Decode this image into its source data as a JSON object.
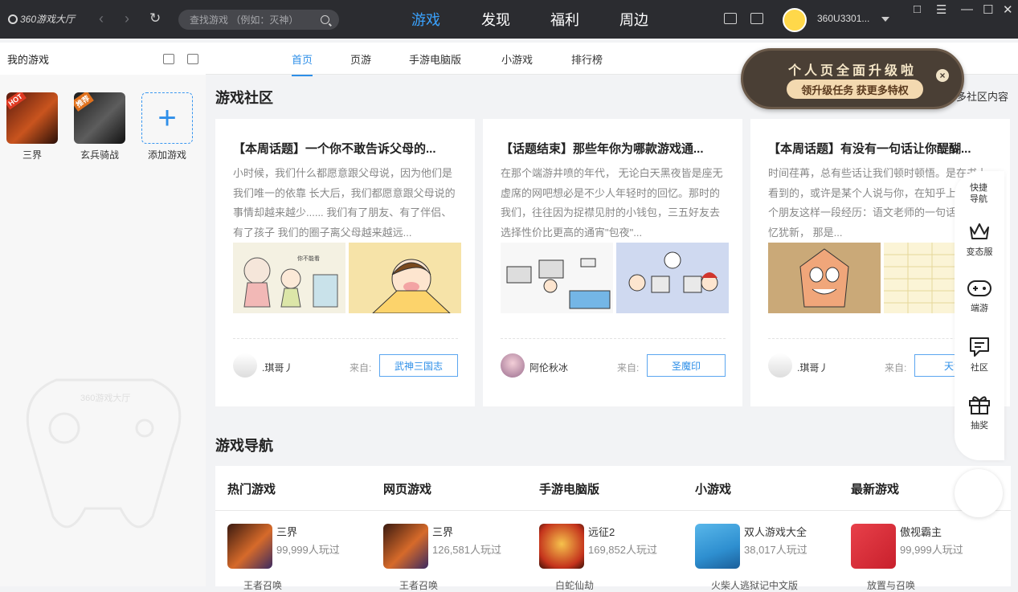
{
  "topbar": {
    "logo_text": "360游戏大厅",
    "search_placeholder": "查找游戏 （例如：灭神）",
    "tabs": [
      "游戏",
      "发现",
      "福利",
      "周边"
    ],
    "username": "360U3301..."
  },
  "sidebar": {
    "title": "我的游戏",
    "games": [
      {
        "name": "三界",
        "badge": "HOT"
      },
      {
        "name": "玄兵骑战",
        "badge": "推荐"
      }
    ],
    "add_label": "添加游戏",
    "watermark": "360游戏大厅"
  },
  "subnav": {
    "tabs": [
      "首页",
      "页游",
      "手游电脑版",
      "小游戏",
      "排行榜"
    ]
  },
  "community": {
    "title": "游戏社区",
    "more": "多社区内容",
    "from_label": "来自:",
    "cards": [
      {
        "title": "【本周话题】一个你不敢告诉父母的...",
        "desc": "小时候，我们什么都愿意跟父母说，因为他们是我们唯一的依靠 长大后，我们都愿意跟父母说的事情却越来越少...... 我们有了朋友、有了伴侣、有了孩子 我们的圈子离父母越来越远...",
        "user": ".琪哥丿",
        "tag": "武神三国志",
        "img_text": "你不能看"
      },
      {
        "title": "【话题结束】那些年你为哪款游戏通...",
        "desc": "在那个端游井喷的年代， 无论白天黑夜皆是座无虚席的网吧想必是不少人年轻时的回忆。那时的我们，往往因为捉襟见肘的小钱包，三五好友去选择性价比更高的通宵\"包夜\"...",
        "user": "阿伦秋冰",
        "tag": "圣魔印",
        "img_text": ""
      },
      {
        "title": "【本周话题】有没有一句话让你醍醐...",
        "desc": "时间荏苒，总有些话让我们顿时顿悟。是在书上看到的，或许是某个人说与你，在知乎上看到一个朋友这样一段经历：语文老师的一句话让我记忆犹新， 那是...",
        "user": ".琪哥丿",
        "tag": "天命",
        "img_text": ""
      }
    ]
  },
  "game_nav": {
    "title": "游戏导航",
    "columns": [
      {
        "header": "热门游戏",
        "name": "三界",
        "players": "99,999人玩过",
        "next": "王者召唤"
      },
      {
        "header": "网页游戏",
        "name": "三界",
        "players": "126,581人玩过",
        "next": "王者召唤"
      },
      {
        "header": "手游电脑版",
        "name": "远征2",
        "players": "169,852人玩过",
        "next": "白蛇仙劫"
      },
      {
        "header": "小游戏",
        "name": "双人游戏大全",
        "players": "38,017人玩过",
        "next": "火柴人逃狱记中文版"
      },
      {
        "header": "最新游戏",
        "name": "傲视霸主",
        "players": "99,999人玩过",
        "next": "放置与召唤"
      }
    ]
  },
  "right_bar": {
    "items": [
      "快捷导航",
      "变态服",
      "端游",
      "社区",
      "抽奖"
    ]
  },
  "popup": {
    "title": "个人页全面升级啦",
    "button": "领升级任务 获更多特权",
    "close": "×"
  },
  "colors": {
    "accent": "#2e8fe8",
    "topbar": "#2b2c30",
    "popup": "#4a3f35"
  }
}
